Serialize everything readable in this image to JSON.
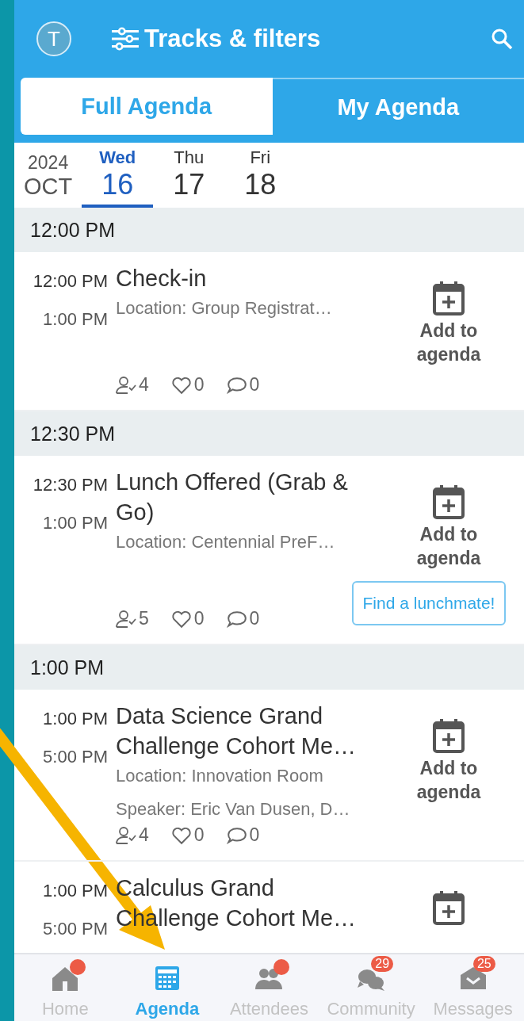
{
  "header": {
    "avatar": "T",
    "title": "Tracks & filters"
  },
  "tabs": [
    {
      "label": "Full Agenda",
      "selected": true
    },
    {
      "label": "My Agenda",
      "selected": false
    }
  ],
  "date_strip": {
    "year": "2024",
    "month": "OCT",
    "days": [
      {
        "weekday": "Wed",
        "day": "16",
        "selected": true
      },
      {
        "weekday": "Thu",
        "day": "17",
        "selected": false
      },
      {
        "weekday": "Fri",
        "day": "18",
        "selected": false
      }
    ]
  },
  "sections": [
    {
      "time": "12:00 PM",
      "sessions": [
        {
          "start": "12:00 PM",
          "end": "1:00 PM",
          "title": "Check-in",
          "location": "Location: Group Registrat…",
          "attendees": "4",
          "likes": "0",
          "comments": "0",
          "add_label": "Add to agenda"
        }
      ]
    },
    {
      "time": "12:30 PM",
      "sessions": [
        {
          "start": "12:30 PM",
          "end": "1:00 PM",
          "title": "Lunch Offered (Grab & Go)",
          "location": "Location: Centennial PreF…",
          "attendees": "5",
          "likes": "0",
          "comments": "0",
          "add_label": "Add to agenda",
          "action": "Find a lunchmate!"
        }
      ]
    },
    {
      "time": "1:00 PM",
      "sessions": [
        {
          "start": "1:00 PM",
          "end": "5:00 PM",
          "title": "Data Science Grand Challenge Cohort Me…",
          "location": "Location: Innovation Room",
          "speaker": "Speaker: Eric Van Dusen, D…",
          "attendees": "4",
          "likes": "0",
          "comments": "0",
          "add_label": "Add to agenda"
        },
        {
          "start": "1:00 PM",
          "end": "5:00 PM",
          "title": "Calculus Grand Challenge Cohort Me…"
        }
      ]
    }
  ],
  "bottom_nav": [
    {
      "label": "Home",
      "kind": "home",
      "selected": false,
      "dot": true
    },
    {
      "label": "Agenda",
      "kind": "agenda",
      "selected": true
    },
    {
      "label": "Attendees",
      "kind": "attendees",
      "selected": false,
      "dot": true
    },
    {
      "label": "Community",
      "kind": "community",
      "selected": false,
      "badge": "29"
    },
    {
      "label": "Messages",
      "kind": "messages",
      "selected": false,
      "badge": "25"
    }
  ]
}
